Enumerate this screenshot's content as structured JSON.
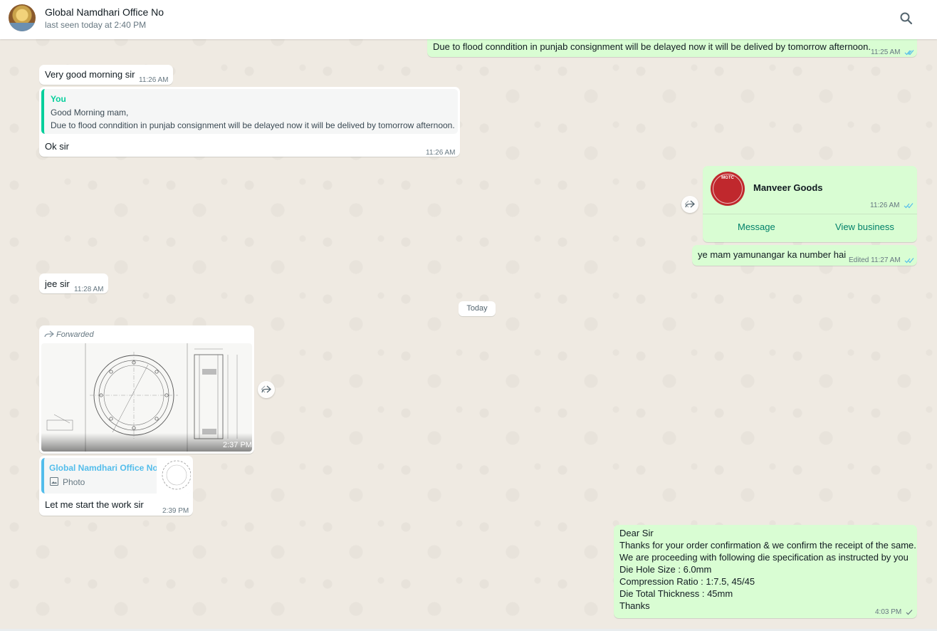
{
  "header": {
    "contact_name": "Global Namdhari Office No",
    "status": "last seen today at 2:40 PM"
  },
  "colors": {
    "incoming": "#ffffff",
    "outgoing": "#d9fdd3",
    "read_tick": "#53bdeb",
    "quote_bar": "#06cf9c"
  },
  "messages": {
    "m1": {
      "text": "Due to flood conndition in punjab consignment will be delayed now it will be delived by tomorrow afternoon.",
      "time": "11:25 AM"
    },
    "m2": {
      "text": "Very good morning sir",
      "time": "11:26 AM"
    },
    "m3": {
      "quote_author": "You",
      "quote_line1": "Good Morning mam,",
      "quote_line2": "Due to flood conndition in punjab consignment will be delayed now it will be delived by tomorrow afternoon.",
      "text": "Ok sir",
      "time": "11:26 AM"
    },
    "m4": {
      "business_name": "Manveer Goods",
      "avatar_label": "MGTC",
      "time": "11:26 AM",
      "action_message": "Message",
      "action_view": "View business"
    },
    "m5": {
      "text": "ye mam yamunangar ka number hai",
      "edited": "Edited",
      "time": "11:27 AM"
    },
    "m6": {
      "text": "jee sir",
      "time": "11:28 AM"
    },
    "date_divider": "Today",
    "m7": {
      "forwarded_label": "Forwarded",
      "time": "2:37 PM"
    },
    "m8": {
      "quote_author": "Global Namdhari Office No",
      "quote_type": "Photo",
      "text": "Let me start the work sir",
      "time": "2:39 PM"
    },
    "m9": {
      "lines": [
        "Dear Sir",
        "Thanks for your order confirmation & we confirm the receipt of the same.",
        "We are proceeding with following die specification as instructed by you",
        "Die Hole Size : 6.0mm",
        "Compression Ratio : 1:7.5, 45/45",
        "Die Total Thickness : 45mm",
        "Thanks"
      ],
      "time": "4:03 PM"
    }
  },
  "icons": {
    "search": "search-icon",
    "double_check": "double-check-icon",
    "single_check": "check-icon",
    "forward": "forward-icon",
    "photo": "photo-icon"
  }
}
